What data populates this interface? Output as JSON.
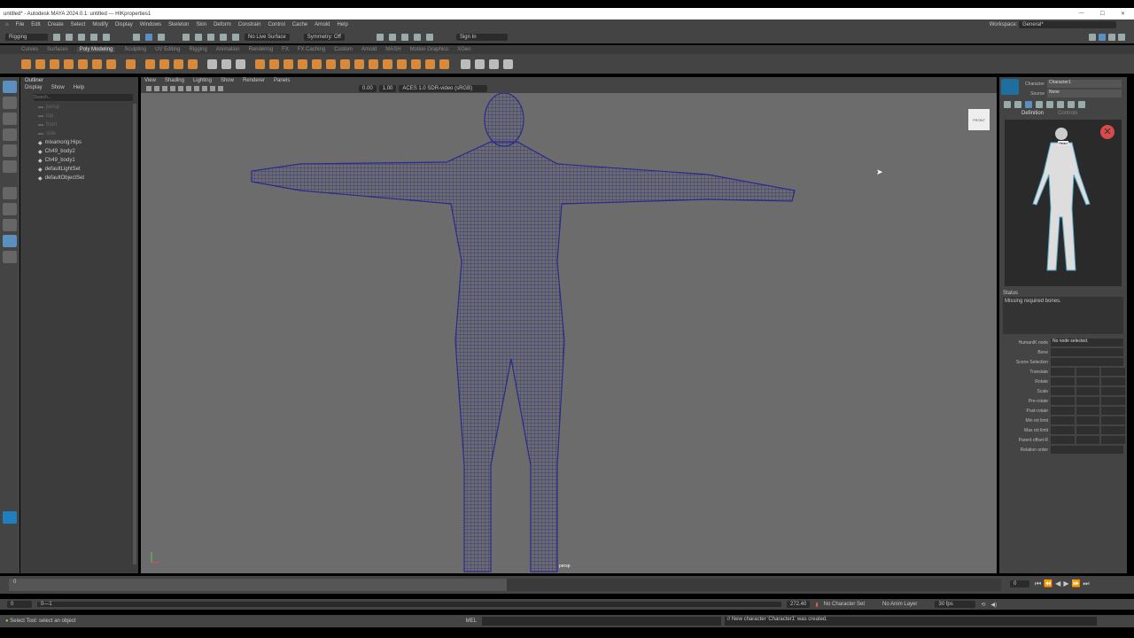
{
  "window": {
    "title": "untitled* - Autodesk MAYA 2024.0.1: untitled  ---  HIKproperties1",
    "controls": [
      "—",
      "☐",
      "✕"
    ]
  },
  "menu": [
    "File",
    "Edit",
    "Create",
    "Select",
    "Modify",
    "Display",
    "Windows",
    "Skeleton",
    "Skin",
    "Deform",
    "Constrain",
    "Control",
    "Cache",
    "Arnold",
    "Help"
  ],
  "statusline": {
    "mode": "Rigging",
    "live_surface": "No Live Surface",
    "symmetry": "Symmetry: Off",
    "sign_in": "Sign In",
    "workspace_label": "Workspace:",
    "workspace": "General*"
  },
  "shelf_tabs": [
    "Curves",
    "Surfaces",
    "Poly Modeling",
    "Sculpting",
    "UV Editing",
    "Rigging",
    "Animation",
    "Rendering",
    "FX",
    "FX Caching",
    "Custom",
    "Arnold",
    "MASH",
    "Motion Graphics",
    "XGen"
  ],
  "shelf_active": "Poly Modeling",
  "outliner": {
    "title": "Outliner",
    "menu": [
      "Display",
      "Show",
      "Help"
    ],
    "search_placeholder": "Search...",
    "items": [
      {
        "label": "persp",
        "dim": true
      },
      {
        "label": "top",
        "dim": true
      },
      {
        "label": "front",
        "dim": true
      },
      {
        "label": "side",
        "dim": true
      },
      {
        "label": "mixamorig:Hips",
        "dim": false
      },
      {
        "label": "Ch49_body2",
        "dim": false
      },
      {
        "label": "Ch49_body1",
        "dim": false
      },
      {
        "label": "defaultLightSet",
        "dim": false
      },
      {
        "label": "defaultObjectSet",
        "dim": false
      }
    ]
  },
  "viewport": {
    "menu": [
      "View",
      "Shading",
      "Lighting",
      "Show",
      "Renderer",
      "Panels"
    ],
    "exposure": "0.00",
    "gamma": "1.00",
    "color_space": "ACES 1.0 SDR-video (sRGB)",
    "camera": "persp",
    "viewcube": "FRONT",
    "wire_color": "#2a2a8c"
  },
  "hik": {
    "character_label": "Character",
    "character": "Character1",
    "source_label": "Source",
    "source": "None",
    "tabs": [
      "Definition",
      "Controls"
    ],
    "head_label": "Head",
    "status_label": "Status",
    "status": "Missing required bones.",
    "fields": [
      {
        "label": "HumanIK node",
        "value": "No node selected."
      },
      {
        "label": "Bone",
        "value": ""
      },
      {
        "label": "Scene Selection",
        "value": ""
      }
    ],
    "vector_fields": [
      "Translate",
      "Rotate",
      "Scale",
      "Pre-rotate",
      "Post-rotate",
      "Min rot limit",
      "Max rot limit",
      "Parent offset R"
    ],
    "relation_label": "Relation order"
  },
  "timeline": {
    "current": "0",
    "start_tick": "0",
    "range_start": "0",
    "range_label": "0—1",
    "range_end": "272.40",
    "char_set": "No Character Set",
    "anim_layer": "No Anim Layer",
    "fps": "30 fps",
    "frame_field": "0"
  },
  "helpline": {
    "text": "Select Tool: select an object",
    "mel_label": "MEL",
    "result": "// New character 'Character1' was created."
  }
}
